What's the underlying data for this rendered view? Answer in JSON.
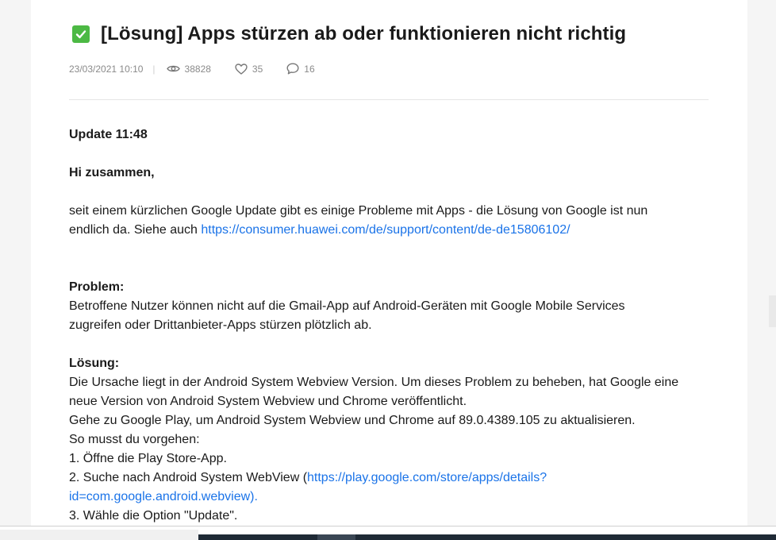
{
  "post": {
    "title": "[Lösung] Apps stürzen ab oder funktionieren nicht richtig",
    "date": "23/03/2021 10:10",
    "separator": "|",
    "views": "38828",
    "likes": "35",
    "comments": "16"
  },
  "body": {
    "update_heading": "Update 11:48",
    "greeting": "Hi zusammen,",
    "intro_line1": "seit einem kürzlichen Google Update gibt es einige Probleme mit Apps - die Lösung von Google ist nun",
    "intro_line2": "endlich da. Siehe auch ",
    "intro_link": "https://consumer.huawei.com/de/support/content/de-de15806102/",
    "problem_heading": "Problem:",
    "problem_line1": "Betroffene Nutzer können nicht auf die Gmail-App auf Android-Geräten mit Google Mobile Services",
    "problem_line2": "zugreifen oder Drittanbieter-Apps stürzen plötzlich ab.",
    "solution_heading": "Lösung:",
    "solution_line1": "Die Ursache liegt in der Android System Webview Version. Um dieses Problem zu beheben, hat Google eine",
    "solution_line2": "neue Version von Android System Webview und Chrome veröffentlicht.",
    "solution_line3": "Gehe zu Google Play, um Android System Webview und Chrome auf 89.0.4389.105 zu aktualisieren.",
    "solution_line4": "So musst du vorgehen:",
    "step1": "1.  Öffne die Play Store-App.",
    "step2_text": "2.  Suche nach Android System WebView (",
    "step2_link_a": "https://play.google.com/store/apps/details?",
    "step2_link_b": "id=com.google.android.webview).",
    "step3": "3.  Wähle die Option \"Update\"."
  },
  "colors": {
    "accent_check": "#4cb944",
    "link": "#1a73e8"
  },
  "icons": {
    "status": "check-box-icon",
    "views": "eye-icon",
    "likes": "heart-icon",
    "comments": "comment-bubble-icon"
  }
}
